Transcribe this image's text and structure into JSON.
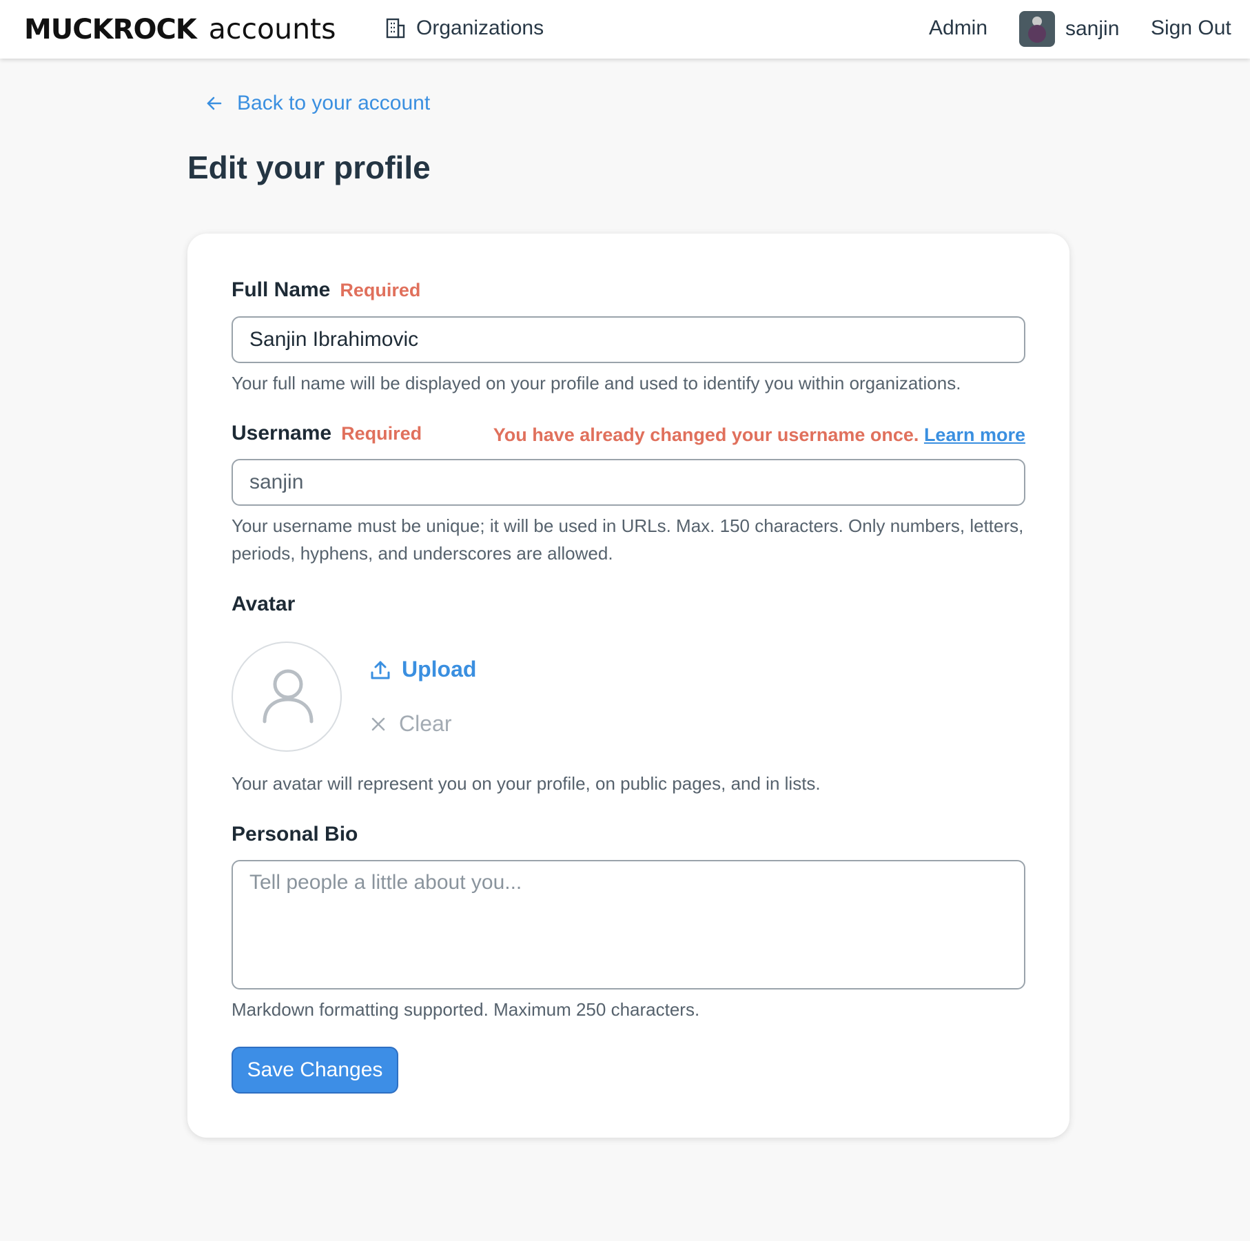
{
  "header": {
    "logo_text": "MUCKROCK",
    "logo_subtext": "accounts",
    "nav_organizations": "Organizations",
    "nav_admin": "Admin",
    "username": "sanjin",
    "sign_out": "Sign Out"
  },
  "back_link": "Back to your account",
  "page_title": "Edit your profile",
  "form": {
    "full_name": {
      "label": "Full Name",
      "required": "Required",
      "value": "Sanjin Ibrahimovic",
      "help": "Your full name will be displayed on your profile and used to identify you within organizations."
    },
    "username": {
      "label": "Username",
      "required": "Required",
      "warning": "You have already changed your username once.",
      "learn_more": "Learn more",
      "value": "sanjin",
      "help": "Your username must be unique; it will be used in URLs. Max. 150 characters. Only numbers, letters, periods, hyphens, and underscores are allowed."
    },
    "avatar": {
      "label": "Avatar",
      "upload": "Upload",
      "clear": "Clear",
      "help": "Your avatar will represent you on your profile, on public pages, and in lists."
    },
    "bio": {
      "label": "Personal Bio",
      "placeholder": "Tell people a little about you...",
      "value": "",
      "help": "Markdown formatting supported. Maximum 250 characters."
    },
    "save": "Save Changes"
  },
  "colors": {
    "accent": "#3a8fe0",
    "required": "#e0705c",
    "button": "#3d8ee6"
  },
  "icons": [
    "building-icon",
    "arrow-left-icon",
    "user-icon",
    "upload-icon",
    "x-icon"
  ]
}
